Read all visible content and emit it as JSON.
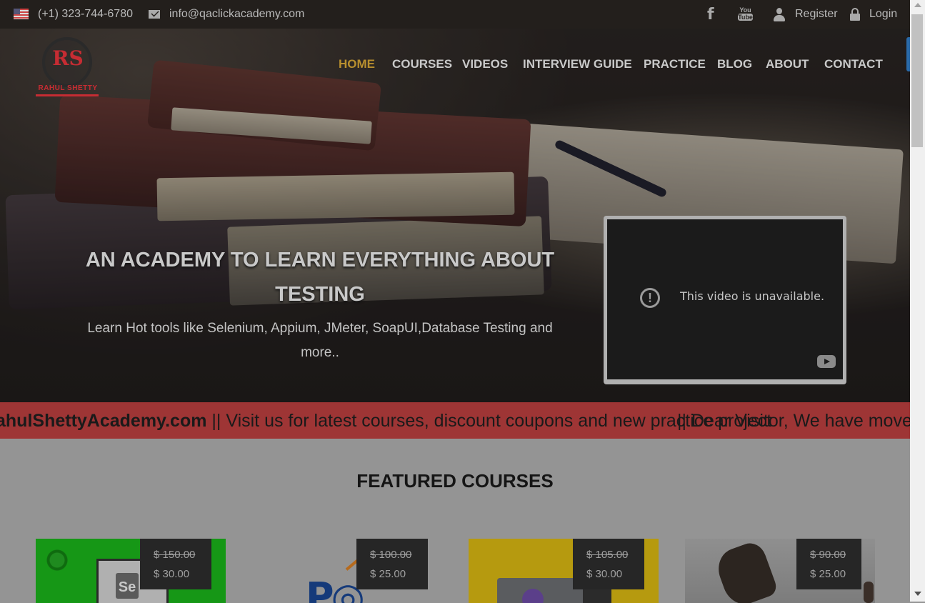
{
  "topbar": {
    "phone": "(+1) 323-744-6780",
    "email": "info@qaclickacademy.com",
    "register": "Register",
    "login": "Login",
    "youtube_icon_text_top": "You",
    "youtube_icon_text_bottom": "Tube"
  },
  "logo": {
    "monogram": "RS",
    "brand": "RAHUL SHETTY"
  },
  "nav": {
    "items": [
      "HOME",
      "COURSES",
      "VIDEOS",
      "INTERVIEW GUIDE",
      "PRACTICE",
      "BLOG",
      "ABOUT",
      "CONTACT"
    ],
    "active": "HOME"
  },
  "hero": {
    "title": "AN ACADEMY TO LEARN EVERYTHING ABOUT TESTING",
    "subtitle": "Learn Hot tools like Selenium, Appium, JMeter, SoapUI,Database Testing and more.."
  },
  "video": {
    "message": "This video is unavailable."
  },
  "ticker": {
    "bold_part": "ahulShettyAcademy.com",
    "rest": " || Visit us for latest courses, discount coupons and new practice project",
    "second": "|| Dear Visitor, We have moved"
  },
  "featured": {
    "title": "FEATURED COURSES",
    "courses": [
      {
        "old_price": "$ 150.00",
        "new_price": "$ 30.00"
      },
      {
        "old_price": "$ 100.00",
        "new_price": "$ 25.00"
      },
      {
        "old_price": "$ 105.00",
        "new_price": "$ 30.00"
      },
      {
        "old_price": "$ 90.00",
        "new_price": "$ 25.00"
      }
    ]
  },
  "colors": {
    "topbar_bg": "#231f1c",
    "active_nav": "#b88f2e",
    "ticker_bg": "#9e3535",
    "brand_red": "#c62c33"
  }
}
